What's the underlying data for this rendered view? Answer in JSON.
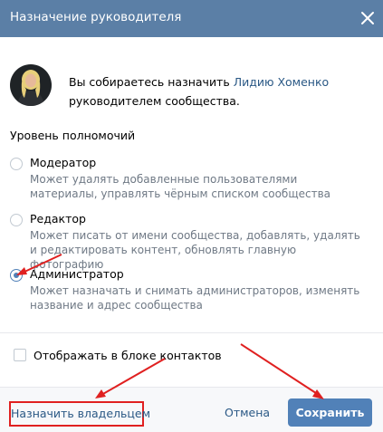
{
  "dialog": {
    "title": "Назначение руководителя"
  },
  "intro": {
    "prefix": "Вы собираетесь назначить ",
    "user_link": "Лидию Хоменко",
    "suffix": "руководителем сообщества."
  },
  "permissions": {
    "title": "Уровень полномочий",
    "options": [
      {
        "label": "Модератор",
        "description": "Может удалять добавленные пользователями материалы, управлять чёрным списком сообщества",
        "checked": false
      },
      {
        "label": "Редактор",
        "description": "Может писать от имени сообщества, добавлять, удалять и редактировать контент, обновлять главную фотографию",
        "checked": false
      },
      {
        "label": "Администратор",
        "description": "Может назначать и снимать администраторов, изменять название и адрес сообщества",
        "checked": true
      }
    ]
  },
  "contacts_checkbox": {
    "label": "Отображать в блоке контактов",
    "checked": false
  },
  "footer": {
    "owner_link": "Назначить владельцем",
    "cancel": "Отмена",
    "save": "Сохранить"
  },
  "colors": {
    "header": "#5b7fa6",
    "accent": "#5181b8",
    "link": "#2a5885",
    "annotation": "#e02020"
  }
}
